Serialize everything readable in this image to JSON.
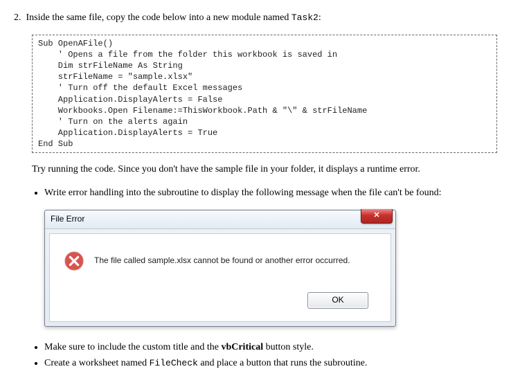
{
  "step": {
    "number": "2.",
    "text_before": "Inside the same file, copy the code below into a new module named ",
    "module_name": "Task2",
    "text_after": ":"
  },
  "code": "Sub OpenAFile()\n    ' Opens a file from the folder this workbook is saved in\n    Dim strFileName As String\n    strFileName = \"sample.xlsx\"\n    ' Turn off the default Excel messages\n    Application.DisplayAlerts = False\n    Workbooks.Open Filename:=ThisWorkbook.Path & \"\\\" & strFileName\n    ' Turn on the alerts again\n    Application.DisplayAlerts = True\nEnd Sub",
  "after_code_para": "Try running the code. Since you don't have the sample file in your folder, it displays a runtime error.",
  "bullet_top": "Write error handling into the subroutine to display the following message when the file can't be found:",
  "dialog": {
    "title": "File Error",
    "close_glyph": "✕",
    "message": "The file called sample.xlsx cannot be found or another error occurred.",
    "ok_label": "OK"
  },
  "final_bullets": {
    "b1_pre": "Make sure to include the custom title and the ",
    "b1_bold": "vbCritical",
    "b1_post": " button style.",
    "b2_pre": "Create a worksheet named ",
    "b2_code": "FileCheck",
    "b2_post": " and place a button that runs the subroutine."
  }
}
